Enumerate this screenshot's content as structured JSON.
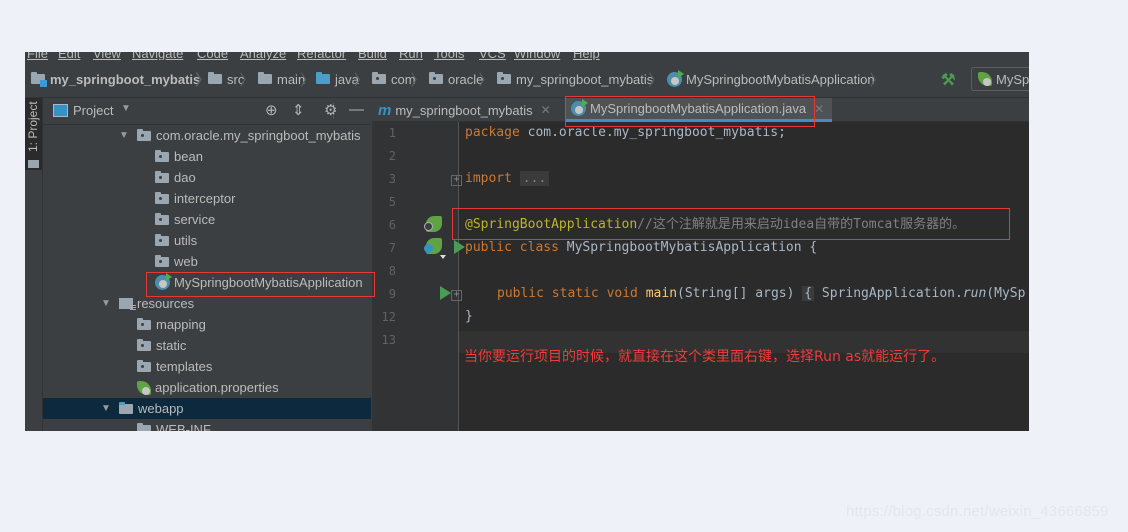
{
  "menu": [
    "File",
    "Edit",
    "View",
    "Navigate",
    "Code",
    "Analyze",
    "Refactor",
    "Build",
    "Run",
    "Tools",
    "VCS",
    "Window",
    "Help"
  ],
  "breadcrumb": [
    {
      "label": "my_springboot_mybatis",
      "icon": "module-folder-icon"
    },
    {
      "label": "src",
      "icon": "folder-icon"
    },
    {
      "label": "main",
      "icon": "folder-icon"
    },
    {
      "label": "java",
      "icon": "source-folder-icon"
    },
    {
      "label": "com",
      "icon": "package-icon"
    },
    {
      "label": "oracle",
      "icon": "package-icon"
    },
    {
      "label": "my_springboot_mybatis",
      "icon": "package-icon"
    },
    {
      "label": "MySpringbootMybatisApplication",
      "icon": "spring-boot-class-icon"
    }
  ],
  "toolbar": {
    "run_config_label": "MySp"
  },
  "tool_stripe": {
    "project_label": "1: Project"
  },
  "project_panel": {
    "title": "Project",
    "tree": [
      {
        "label": "com.oracle.my_springboot_mybatis",
        "type": "package",
        "expanded": true
      },
      {
        "label": "bean",
        "type": "package"
      },
      {
        "label": "dao",
        "type": "package"
      },
      {
        "label": "interceptor",
        "type": "package"
      },
      {
        "label": "service",
        "type": "package"
      },
      {
        "label": "utils",
        "type": "package"
      },
      {
        "label": "web",
        "type": "package"
      },
      {
        "label": "MySpringbootMybatisApplication",
        "type": "spring-class"
      },
      {
        "label": "resources",
        "type": "resources",
        "expanded": true
      },
      {
        "label": "mapping",
        "type": "package"
      },
      {
        "label": "static",
        "type": "package"
      },
      {
        "label": "templates",
        "type": "package"
      },
      {
        "label": "application.properties",
        "type": "spring-properties"
      },
      {
        "label": "webapp",
        "type": "web-folder",
        "expanded": true,
        "selected": true
      },
      {
        "label": "WEB-INF",
        "type": "folder"
      }
    ]
  },
  "editor": {
    "tabs": [
      {
        "label": "my_springboot_mybatis",
        "icon": "maven-icon",
        "active": false
      },
      {
        "label": "MySpringbootMybatisApplication.java",
        "icon": "spring-boot-class-icon",
        "active": true
      }
    ],
    "line_numbers": [
      "1",
      "2",
      "3",
      "5",
      "6",
      "7",
      "8",
      "9",
      "12",
      "13"
    ],
    "code": {
      "l1_kw": "package",
      "l1_rest": " com.oracle.my_springboot_mybatis;",
      "l3_kw": "import",
      "l3_fold": "...",
      "l6_ann": "@SpringBootApplication",
      "l6_cmt": "//这个注解就是用来启动idea自带的Tomcat服务器的。",
      "l7_kw": "public class",
      "l7_rest": " MySpringbootMybatisApplication {",
      "l9_kw": "public static void",
      "l9_fn": "main",
      "l9_args": "(String[] args)",
      "l9_brace": "{",
      "l9_body": " SpringApplication.",
      "l9_run": "run",
      "l9_tail": "(MySp",
      "l12": "}"
    }
  },
  "annotation_note": "当你要运行项目的时候，就直接在这个类里面右键，选择Run as就能运行了。",
  "watermark": "https://blog.csdn.net/weixin_43666859",
  "colors": {
    "highlight_box": "#e53935",
    "note_text": "#f23b3b",
    "selection": "#0d293e",
    "tab_underline": "#4a88c7"
  }
}
